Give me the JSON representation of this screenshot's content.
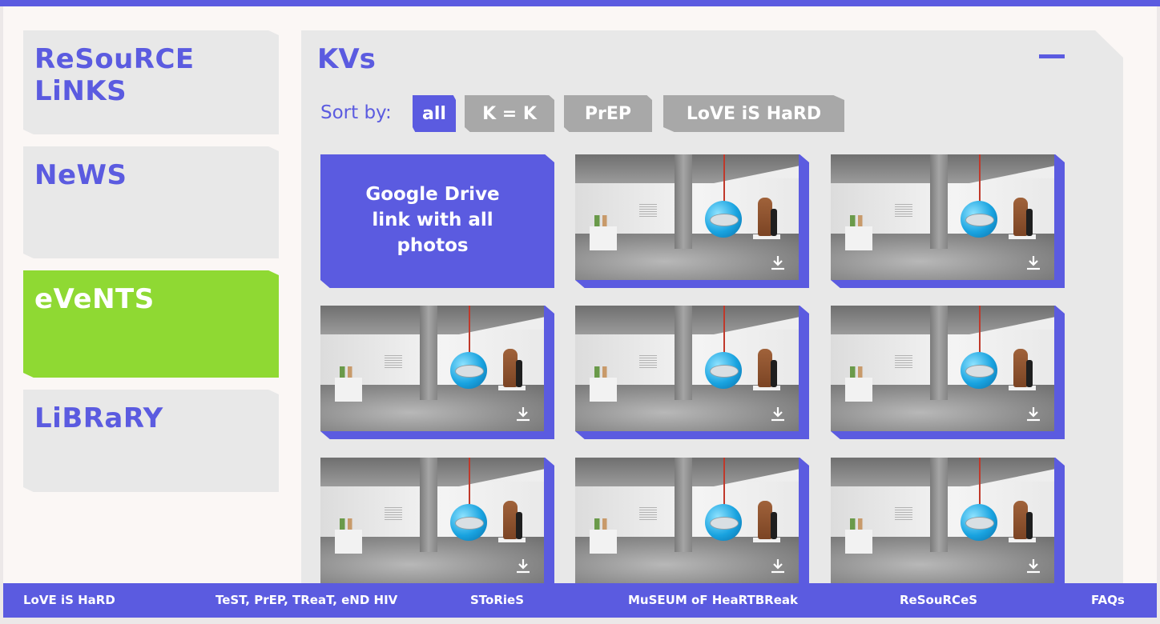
{
  "colors": {
    "accent": "#5b5be0",
    "active": "#8fd933",
    "card": "#e8e8e8",
    "chip_inactive": "#a8a8a8"
  },
  "sidebar": {
    "items": [
      {
        "label": "ReSouRCE LiNKS",
        "active": false
      },
      {
        "label": "NeWS",
        "active": false
      },
      {
        "label": "eVeNTS",
        "active": true
      },
      {
        "label": "LiBRaRY",
        "active": false
      }
    ]
  },
  "main": {
    "title": "KVs",
    "collapse_icon": "minus-icon",
    "sort_label": "Sort by:",
    "filters": [
      {
        "label": "all",
        "active": true
      },
      {
        "label": "K = K",
        "active": false
      },
      {
        "label": "PrEP",
        "active": false
      },
      {
        "label": "LoVE iS HaRD",
        "active": false
      }
    ],
    "drive_link": "Google Drive link with all photos",
    "photo_count": 8,
    "download_icon": "download-icon"
  },
  "footer": {
    "links": [
      "LoVE iS HaRD",
      "TeST, PrEP, TReaT, eND HIV",
      "SToRieS",
      "MuSEUM oF HeaRTBReak",
      "ReSouRCeS",
      "FAQs"
    ]
  }
}
